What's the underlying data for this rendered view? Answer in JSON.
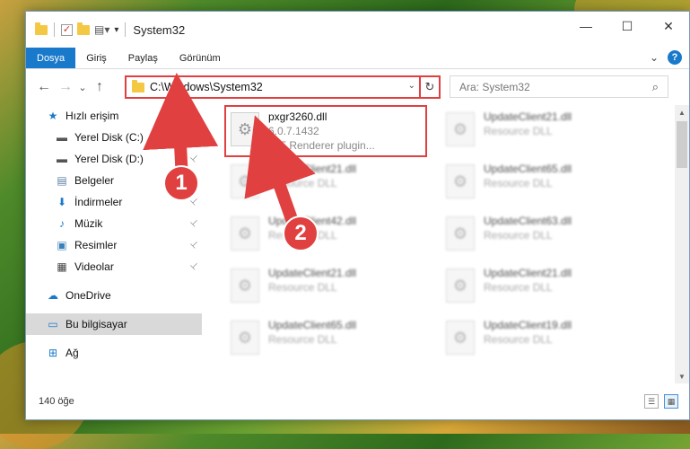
{
  "window": {
    "title": "System32",
    "controls": {
      "minimize": "—",
      "maximize": "☐",
      "close": "✕"
    }
  },
  "ribbon": {
    "tabs": [
      "Dosya",
      "Giriş",
      "Paylaş",
      "Görünüm"
    ],
    "active_tab": "Dosya",
    "expand_glyph": "⌄",
    "help_glyph": "?"
  },
  "nav": {
    "back": "←",
    "forward": "→",
    "recent": "⌄",
    "up": "↑",
    "address_path": "C:\\Windows\\System32",
    "address_dropdown": "⌄",
    "refresh": "↻",
    "search_placeholder": "Ara: System32",
    "search_icon": "⌕"
  },
  "sidebar": {
    "items": [
      {
        "label": "Hızlı erişim",
        "icon": "star-icon",
        "glyph": "★",
        "color": "#1979ca",
        "pinned": false,
        "indent": false
      },
      {
        "label": "Yerel Disk (C:)",
        "icon": "drive-icon",
        "glyph": "▬",
        "color": "#555555",
        "pinned": true,
        "indent": true
      },
      {
        "label": "Yerel Disk (D:)",
        "icon": "drive-icon",
        "glyph": "▬",
        "color": "#555555",
        "pinned": true,
        "indent": true
      },
      {
        "label": "Belgeler",
        "icon": "documents-icon",
        "glyph": "▤",
        "color": "#5b7fa6",
        "pinned": true,
        "indent": true
      },
      {
        "label": "İndirmeler",
        "icon": "download-icon",
        "glyph": "⬇",
        "color": "#1979ca",
        "pinned": true,
        "indent": true
      },
      {
        "label": "Müzik",
        "icon": "music-icon",
        "glyph": "♪",
        "color": "#1979ca",
        "pinned": true,
        "indent": true
      },
      {
        "label": "Resimler",
        "icon": "pictures-icon",
        "glyph": "▣",
        "color": "#3a7fb8",
        "pinned": true,
        "indent": true
      },
      {
        "label": "Videolar",
        "icon": "videos-icon",
        "glyph": "▦",
        "color": "#444444",
        "pinned": true,
        "indent": true
      },
      {
        "label": "OneDrive",
        "icon": "cloud-icon",
        "glyph": "☁",
        "color": "#1979ca",
        "pinned": false,
        "indent": false
      },
      {
        "label": "Bu bilgisayar",
        "icon": "computer-icon",
        "glyph": "▭",
        "color": "#1979ca",
        "pinned": false,
        "indent": false,
        "selected": true
      },
      {
        "label": "Ağ",
        "icon": "network-icon",
        "glyph": "⊞",
        "color": "#1979ca",
        "pinned": false,
        "indent": false
      }
    ],
    "pin_glyph": "📌"
  },
  "files": [
    {
      "name": "pxgr3260.dll",
      "line2": "6.0.7.1432",
      "line3": "GIF Renderer plugin...",
      "highlighted": true
    },
    {
      "name": "UpdateClient21.dll",
      "line2": "Resource DLL",
      "blurred": true
    },
    {
      "name": "UpdateClient21.dll",
      "line2": "Resource DLL",
      "blurred": true
    },
    {
      "name": "UpdateClient65.dll",
      "line2": "Resource DLL",
      "blurred": true
    },
    {
      "name": "UpdateClient42.dll",
      "line2": "Resource DLL",
      "blurred": true
    },
    {
      "name": "UpdateClient63.dll",
      "line2": "Resource DLL",
      "blurred": true
    },
    {
      "name": "UpdateClient21.dll",
      "line2": "Resource DLL",
      "blurred": true
    },
    {
      "name": "UpdateClient21.dll",
      "line2": "Resource DLL",
      "blurred": true
    },
    {
      "name": "UpdateClient65.dll",
      "line2": "Resource DLL",
      "blurred": true
    },
    {
      "name": "UpdateClient19.dll",
      "line2": "Resource DLL",
      "blurred": true
    }
  ],
  "file_icon_glyph": "⚙",
  "status": {
    "item_count": "140 öğe",
    "view_details_glyph": "☰",
    "view_tiles_glyph": "▦"
  },
  "annotations": {
    "badge1": "1",
    "badge2": "2",
    "color": "#e04040"
  }
}
